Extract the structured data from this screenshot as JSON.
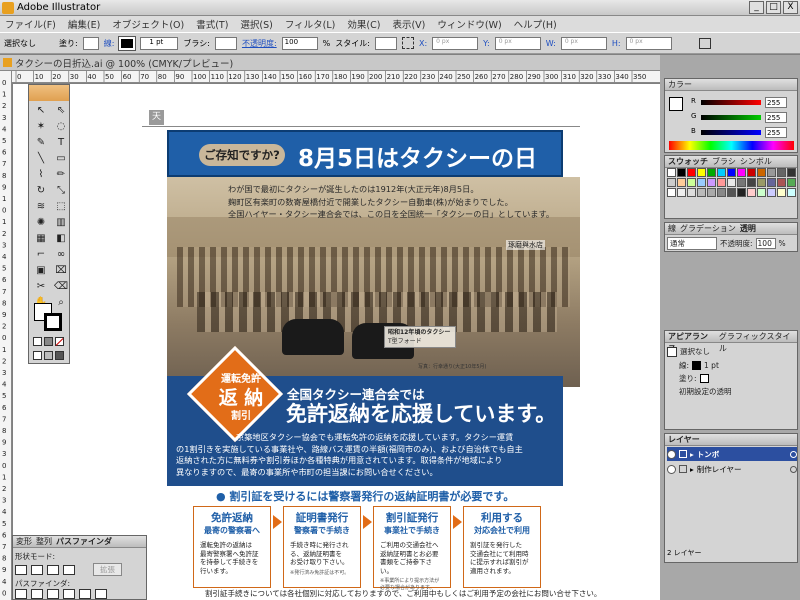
{
  "app": {
    "title": "Adobe Illustrator"
  },
  "window_buttons": [
    "_",
    "□",
    "X"
  ],
  "menus": [
    "ファイル(F)",
    "編集(E)",
    "オブジェクト(O)",
    "書式(T)",
    "選択(S)",
    "フィルタ(L)",
    "効果(C)",
    "表示(V)",
    "ウィンドウ(W)",
    "ヘルプ(H)"
  ],
  "control": {
    "selection": "選択なし",
    "fill": "塗り:",
    "stroke": "線:",
    "stroke_weight": "1 pt",
    "brush": "ブラシ:",
    "opacity_label": "不透明度:",
    "opacity_value": "100",
    "pct": "%",
    "style": "スタイル:",
    "x": "X:",
    "x_val": "0 px",
    "y": "Y:",
    "y_val": "0 px",
    "w": "W:",
    "w_val": "0 px",
    "h": "H:",
    "h_val": "0 px"
  },
  "document": {
    "tab": "タクシーの日折込.ai @ 100% (CMYK/プレビュー)"
  },
  "ruler_h": [
    "0",
    "10",
    "20",
    "30",
    "40",
    "50",
    "60",
    "70",
    "80",
    "90",
    "100",
    "110",
    "120",
    "130",
    "140",
    "150",
    "160",
    "170",
    "180",
    "190",
    "200",
    "210",
    "220",
    "230",
    "240",
    "250",
    "260",
    "270",
    "280",
    "290",
    "300",
    "310",
    "320",
    "330",
    "340",
    "350"
  ],
  "ruler_v": [
    "0",
    "1",
    "2",
    "3",
    "4",
    "5",
    "6",
    "7",
    "8",
    "9",
    "1",
    "0",
    "1",
    "2",
    "3",
    "4",
    "5",
    "6",
    "7",
    "8",
    "9",
    "2",
    "0",
    "1",
    "2",
    "3",
    "4",
    "5",
    "6",
    "7",
    "8",
    "9",
    "3",
    "0",
    "1",
    "2",
    "3",
    "4",
    "5",
    "6",
    "7",
    "8",
    "9",
    "4",
    "0"
  ],
  "poster": {
    "corner_tag": "天",
    "pill": "ご存知ですか?",
    "title": "8月5日はタクシーの日",
    "intro": [
      "わが国で最初にタクシーが誕生したのは1912年(大正元年)8月5日。",
      "麹町区有楽町の数寄屋橋付近で開業したタクシー自動車(株)が始まりでした。",
      "全国ハイヤー・タクシー連合会では、この日を全国統一「タクシーの日」としています。"
    ],
    "sign_text": "琢磨與水店",
    "car_caption": "昭和12年頃のタクシー",
    "car_caption_sub": "T型フォード",
    "photo_caption": "写真：行幸通り(大正10年5月)",
    "diamond_top": "運転免許",
    "diamond_mid": "返 納",
    "diamond_bottom": "割引",
    "sub1": "全国タクシー連合会では",
    "sub2": "免許返納を応援しています。",
    "body": [
      "京築地区タクシー協会でも運転免許の返納を応援しています。タクシー運賃",
      "の1割引きを実施している事業社や、路線バス運賃の半額(福岡市のみ)、および自治体でも自主",
      "返納された方に無料券や割引券ほか各種特典が用意されています。取得条件が地域により",
      "異なりますので、最寄の事業所や市町の担当課にお問い合せください。"
    ],
    "cards_header": "● 割引証を受けるには警察署発行の返納証明書が必要です。",
    "cards": [
      {
        "h1": "免許返納",
        "h2": "最寄の警察署へ",
        "text": [
          "運転免許の返納は",
          "最寄警察署へ免許証",
          "を持参して手続きを",
          "行います。"
        ],
        "note": ""
      },
      {
        "h1": "証明書発行",
        "h2": "警察署で手続き",
        "text": [
          "手続き時に発行され",
          "る、返納証明書を",
          "お受け取り下さい。"
        ],
        "note": "※発行済み免許証は不可。"
      },
      {
        "h1": "割引証発行",
        "h2": "事業社で手続き",
        "text": [
          "ご利用の交通会社へ",
          "返納証明書とお必要",
          "書類をご持参下さい。"
        ],
        "note": "※事業所により提示方法が必要な場合があります。"
      },
      {
        "h1": "利用する",
        "h2": "対応会社で利用",
        "text": [
          "割引証を発行した",
          "交通会社にて利用時",
          "に提示すれば割引が",
          "適用されます。"
        ],
        "note": ""
      }
    ],
    "footnote": "割引証手続きについては各社個別に対応しておりますので、ご利用中もしくはご利用予定の会社にお問い合せ下さい。"
  },
  "panels": {
    "color": {
      "title": "カラー",
      "r": "R",
      "g": "G",
      "b": "B",
      "r_val": "255",
      "g_val": "255",
      "b_val": "255"
    },
    "swatches": {
      "tabs": [
        "スウォッチ",
        "ブラシ",
        "シンボル"
      ]
    },
    "transparency": {
      "tabs": [
        "線",
        "グラデーション",
        "透明"
      ],
      "mode": "通常",
      "opacity_label": "不透明度:",
      "opacity_val": "100",
      "pct": "%"
    },
    "appearance": {
      "tabs": [
        "アピアランス",
        "グラフィックスタイル"
      ],
      "selection": "選択なし",
      "stroke": "線:",
      "stroke_val": "1 pt",
      "fill": "塗り:",
      "transparency": "初期設定の透明"
    },
    "layers": {
      "tab": "レイヤー",
      "items": [
        "トンボ",
        "制作レイヤー"
      ],
      "footer": "2 レイヤー"
    },
    "pathfinder": {
      "tabs": [
        "変形",
        "整列",
        "パスファインダ"
      ],
      "shape_mode": "形状モード:",
      "expand": "拡張",
      "pathfinder_label": "パスファインダ:"
    }
  },
  "colors": {
    "banner_blue": "#1f5fa8",
    "accent_orange": "#e26d18",
    "card_blue": "#1f4e8c"
  }
}
